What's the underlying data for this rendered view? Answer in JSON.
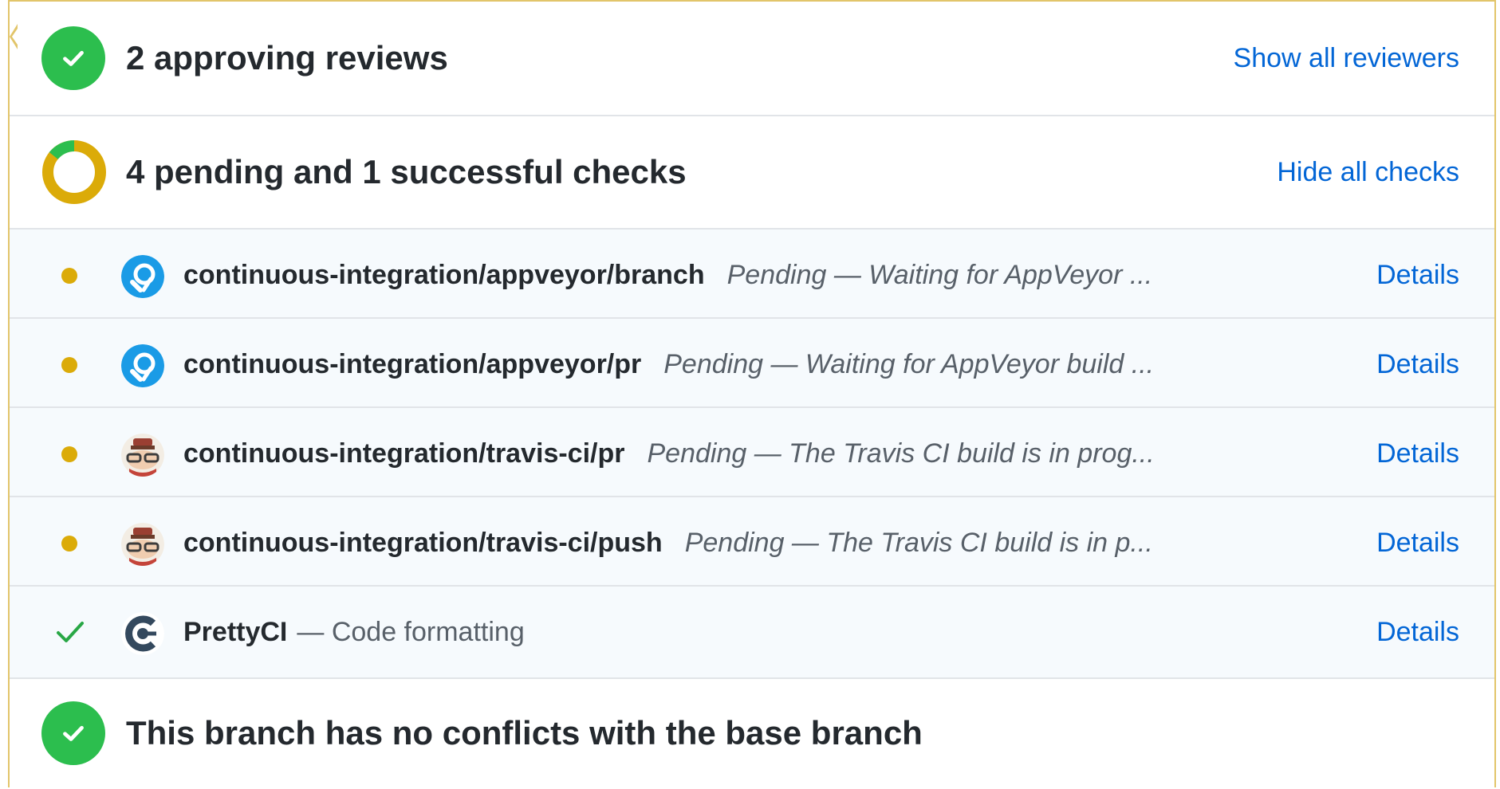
{
  "reviews": {
    "title": "2 approving reviews",
    "link": "Show all reviewers"
  },
  "checks_summary": {
    "title": "4 pending and 1 successful checks",
    "link": "Hide all checks"
  },
  "checks": [
    {
      "name": "continuous-integration/appveyor/branch",
      "description": "Pending — Waiting for AppVeyor ...",
      "status": "pending",
      "icon": "appveyor-icon",
      "details": "Details"
    },
    {
      "name": "continuous-integration/appveyor/pr",
      "description": "Pending — Waiting for AppVeyor build ...",
      "status": "pending",
      "icon": "appveyor-icon",
      "details": "Details"
    },
    {
      "name": "continuous-integration/travis-ci/pr",
      "description": "Pending — The Travis CI build is in prog...",
      "status": "pending",
      "icon": "travis-ci-icon",
      "details": "Details"
    },
    {
      "name": "continuous-integration/travis-ci/push",
      "description": "Pending — The Travis CI build is in p...",
      "status": "pending",
      "icon": "travis-ci-icon",
      "details": "Details"
    },
    {
      "name": "PrettyCI",
      "description": "— Code formatting",
      "status": "success",
      "icon": "prettyci-icon",
      "details": "Details"
    }
  ],
  "merge": {
    "title": "This branch has no conflicts with the base branch"
  },
  "colors": {
    "success": "#2cbe4e",
    "pending": "#dbab09",
    "link": "#0366d6",
    "panel_border": "#e2c56a"
  }
}
